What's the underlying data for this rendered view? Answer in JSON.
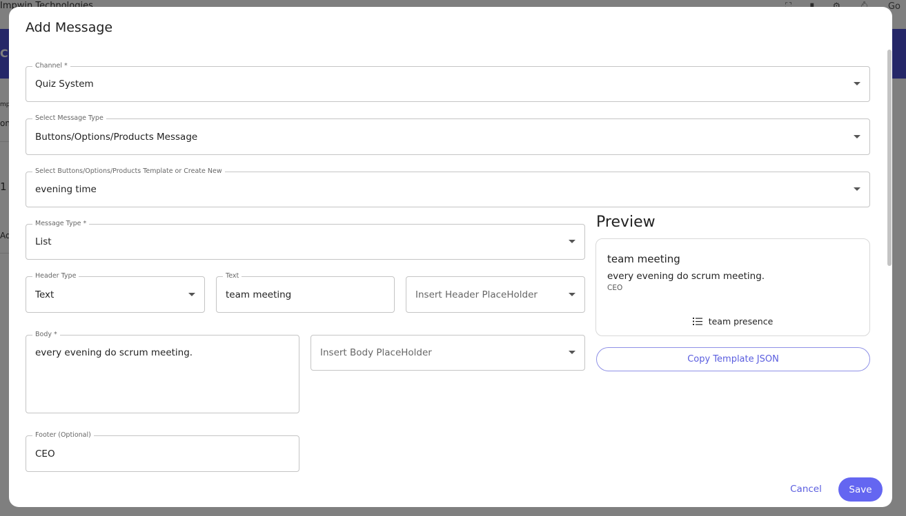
{
  "background": {
    "company": "Impwin Technologies",
    "top_right_text": "Go",
    "banner_text": "Cr",
    "fragments": [
      "mpa",
      "on",
      "1",
      "Ad"
    ]
  },
  "dialog": {
    "title": "Add Message",
    "fields": {
      "channel": {
        "label": "Channel *",
        "value": "Quiz System"
      },
      "message_type_select": {
        "label": "Select Message Type",
        "value": "Buttons/Options/Products Message"
      },
      "template": {
        "label": "Select Buttons/Options/Products Template or Create New",
        "value": "evening time"
      },
      "message_type": {
        "label": "Message Type *",
        "value": "List"
      },
      "header_type": {
        "label": "Header Type",
        "value": "Text"
      },
      "header_text": {
        "label": "Text",
        "value": "team meeting"
      },
      "header_placeholder": {
        "placeholder": "Insert Header PlaceHolder"
      },
      "body": {
        "label": "Body *",
        "value": "every evening do scrum meeting."
      },
      "body_placeholder": {
        "placeholder": "Insert Body PlaceHolder"
      },
      "footer": {
        "label": "Footer (Optional)",
        "value": "CEO"
      }
    },
    "preview": {
      "title": "Preview",
      "header": "team meeting",
      "body": "every evening do scrum meeting.",
      "footer": "CEO",
      "button_icon": "list-icon",
      "button_label": "team presence"
    },
    "copy_button": "Copy Template JSON",
    "cancel_button": "Cancel",
    "save_button": "Save"
  },
  "colors": {
    "accent": "#6466f1",
    "accent_text": "#5a5ddf",
    "banner": "#4b4fd1",
    "overlay": "rgba(0,0,0,0.5)"
  }
}
